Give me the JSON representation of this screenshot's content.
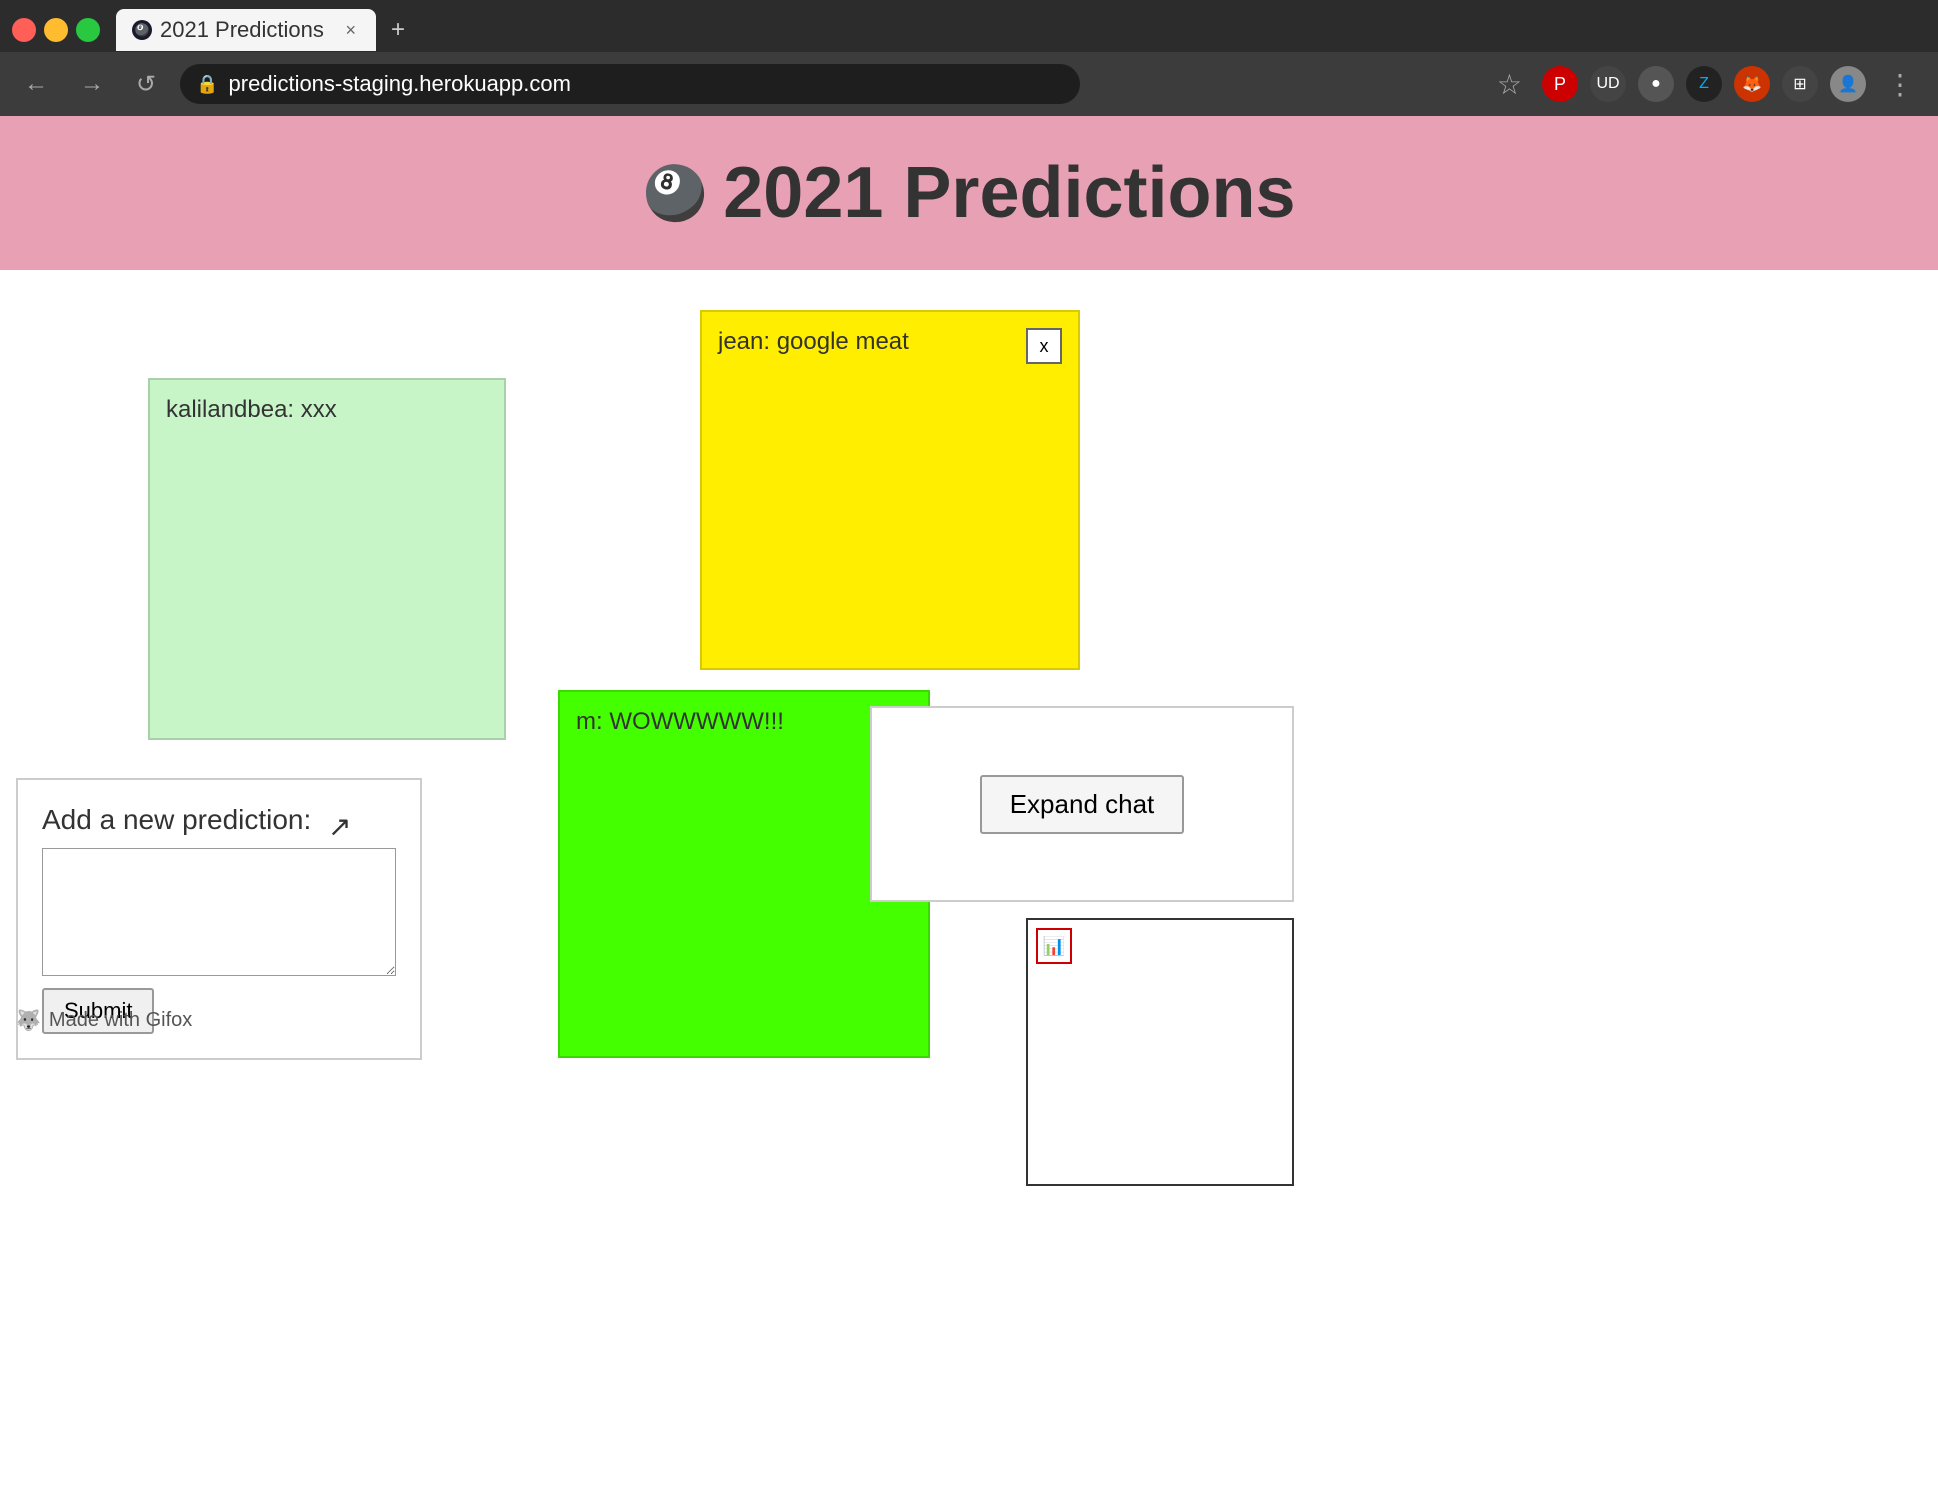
{
  "browser": {
    "tab_title": "2021 Predictions",
    "tab_close": "×",
    "new_tab": "+",
    "url": "predictions-staging.herokuapp.com",
    "back_label": "←",
    "forward_label": "→",
    "reload_label": "↺",
    "bookmark_label": "☆",
    "menu_label": "⋮"
  },
  "header": {
    "emoji": "🎱",
    "title": "2021 Predictions"
  },
  "notes": {
    "green_light": {
      "text": "kalilandbea: xxx"
    },
    "yellow": {
      "text": "jean: google meat",
      "close": "x"
    },
    "bright_green": {
      "text": "m: WOWWWWW!!!"
    }
  },
  "form": {
    "label": "Add a new prediction:",
    "placeholder": "",
    "submit": "Submit"
  },
  "expand_chat": {
    "button": "Expand chat"
  },
  "gifox": {
    "label": "Made with Gifox"
  }
}
